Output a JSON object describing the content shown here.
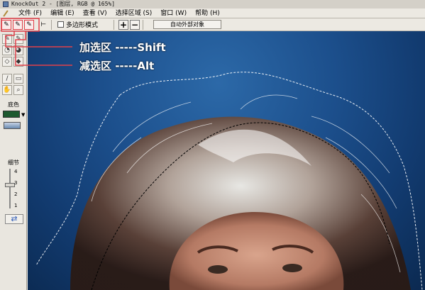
{
  "window": {
    "title": "KnockOut 2 - [图层, RGB @ 165%]"
  },
  "menu": [
    {
      "label": "文件 (F)"
    },
    {
      "label": "编辑 (E)"
    },
    {
      "label": "查看 (V)"
    },
    {
      "label": "选择区域 (S)"
    },
    {
      "label": "窗口 (W)"
    },
    {
      "label": "帮助 (H)"
    }
  ],
  "toolbar": {
    "polygon_mode_label": "多边形模式",
    "plus_label": "+",
    "minus_label": "−",
    "auto_outer_label": "自动外部对象"
  },
  "left_panel": {
    "bg_color_label": "底色",
    "detail_label": "细节",
    "ticks": [
      "4",
      "3",
      "2",
      "1"
    ],
    "bg_color": "#1e5a30"
  },
  "annotations": {
    "add_selection": "加选区 -----Shift",
    "subtract_selection": "减选区 -----Alt",
    "highlight_color": "#e0404a"
  }
}
